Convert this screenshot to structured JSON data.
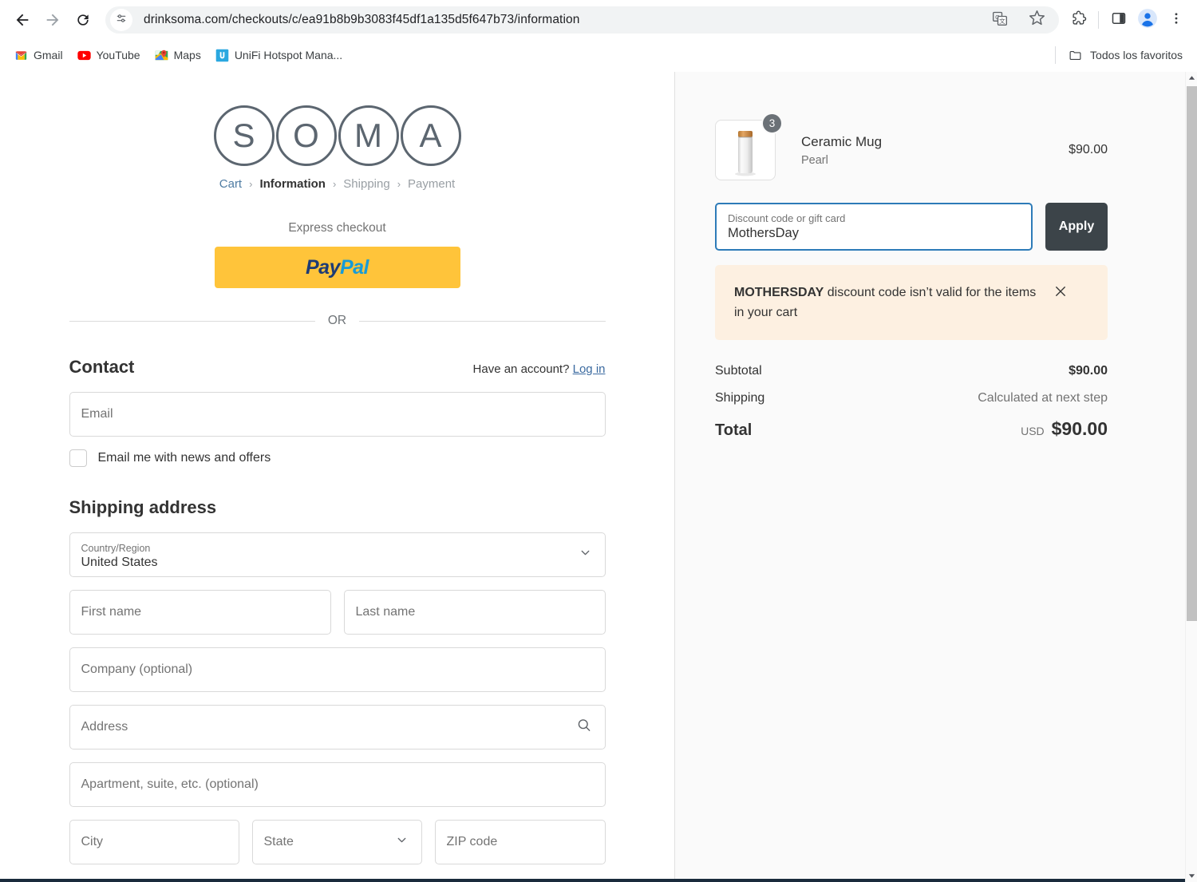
{
  "browser": {
    "url": "drinksoma.com/checkouts/c/ea91b8b9b3083f45df1a135d5f647b73/information",
    "back_icon": "back-arrow-icon",
    "forward_icon": "forward-arrow-icon",
    "reload_icon": "reload-icon",
    "site_info_icon": "site-settings-icon",
    "translate_icon": "translate-icon",
    "bookmark_icon": "star-icon",
    "extensions_icon": "extensions-puzzle-icon",
    "sidepanel_icon": "side-panel-icon",
    "profile_icon": "profile-avatar-icon",
    "menu_icon": "three-dot-menu-icon",
    "bookmarks": [
      {
        "label": "Gmail",
        "icon": "gmail-icon"
      },
      {
        "label": "YouTube",
        "icon": "youtube-icon"
      },
      {
        "label": "Maps",
        "icon": "google-maps-icon"
      },
      {
        "label": "UniFi Hotspot Mana...",
        "icon": "unifi-icon"
      }
    ],
    "all_bookmarks_label": "Todos los favoritos",
    "all_bookmarks_icon": "folder-icon"
  },
  "checkout": {
    "logo_letters": [
      "S",
      "O",
      "M",
      "A"
    ],
    "breadcrumb": [
      {
        "label": "Cart",
        "state": "link"
      },
      {
        "label": "Information",
        "state": "current"
      },
      {
        "label": "Shipping",
        "state": "muted"
      },
      {
        "label": "Payment",
        "state": "muted"
      }
    ],
    "breadcrumb_separator": "›",
    "express_checkout_label": "Express checkout",
    "paypal": {
      "part1": "Pay",
      "part2": "Pal"
    },
    "or_label": "OR",
    "contact": {
      "title": "Contact",
      "account_prompt": "Have an account?",
      "login_label": "Log in",
      "email_placeholder": "Email",
      "newsletter_label": "Email me with news and offers"
    },
    "shipping": {
      "title": "Shipping address",
      "country_label": "Country/Region",
      "country_value": "United States",
      "first_name_placeholder": "First name",
      "last_name_placeholder": "Last name",
      "company_placeholder": "Company (optional)",
      "address_placeholder": "Address",
      "apartment_placeholder": "Apartment, suite, etc. (optional)",
      "city_placeholder": "City",
      "state_placeholder": "State",
      "zip_placeholder": "ZIP code"
    }
  },
  "summary": {
    "product": {
      "name": "Ceramic Mug",
      "variant": "Pearl",
      "price": "$90.00",
      "quantity": "3"
    },
    "discount": {
      "label": "Discount code or gift card",
      "value": "MothersDay",
      "apply_label": "Apply"
    },
    "error": {
      "code": "MOTHERSDAY",
      "message": " discount code isn’t valid for the items in your cart",
      "close_icon": "close-x-icon"
    },
    "totals": {
      "subtotal_label": "Subtotal",
      "subtotal_value": "$90.00",
      "shipping_label": "Shipping",
      "shipping_value": "Calculated at next step",
      "total_label": "Total",
      "total_currency": "USD",
      "total_value": "$90.00"
    }
  },
  "colors": {
    "accent_blue": "#2d7bb8",
    "paypal_yellow": "#ffc43a",
    "apply_dark": "#3c4449",
    "error_bg": "#fdf0e1",
    "sidebar_bg": "#fafafa"
  }
}
